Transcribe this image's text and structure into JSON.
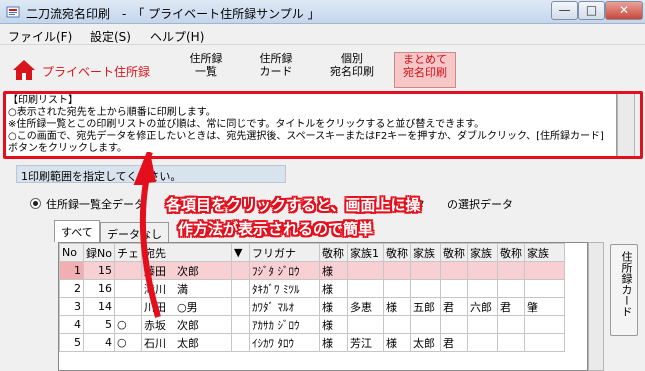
{
  "window": {
    "title": "二刀流宛名印刷　-　「 プライベート住所録サンプル 」",
    "min_label": "—",
    "max_label": "□",
    "close_label": "✕"
  },
  "menu": [
    "ファイル(F)",
    "設定(S)",
    "ヘルプ(H)"
  ],
  "toolbar": {
    "brand_label": "プライベート住所録",
    "buttons": [
      "住所録\n一覧",
      "住所録\nカード",
      "個別\n宛名印刷",
      "まとめて\n宛名印刷"
    ]
  },
  "info": {
    "text": "【印刷リスト】\n○表示された宛先を上から順番に印刷します。\n※住所録一覧とこの印刷リストの並び順は、常に同じです。タイトルをクリックすると並び替えできます。\n○この画面で、宛先データを修正したいときは、宛先選択後、スペースキーまたはF2キーを押すか、ダブルクリック、[住所録カード]ボタンをクリックします。"
  },
  "range": {
    "label": "1印刷範囲を指定してください。",
    "option1": "住所録一覧全データ",
    "option2": "タ　　の選択データ"
  },
  "tabs": [
    "すべて",
    "データなし"
  ],
  "grid": {
    "headers": [
      "No",
      "録No",
      "チェ",
      "宛先",
      "",
      "フリガナ",
      "敬称",
      "家族1",
      "敬称",
      "家族",
      "敬称",
      "家族",
      "敬称",
      "家族"
    ],
    "rows": [
      [
        "1",
        "15",
        "",
        "藤田　次郎",
        "",
        "ﾌｼﾞﾀ ｼﾞﾛｳ",
        "様",
        "",
        "",
        "",
        "",
        "",
        "",
        ""
      ],
      [
        "2",
        "16",
        "",
        "滝川　満",
        "",
        "ﾀｷｶﾞﾜ ﾐﾂﾙ",
        "様",
        "",
        "",
        "",
        "",
        "",
        "",
        ""
      ],
      [
        "3",
        "14",
        "",
        "川田　○男",
        "",
        "ｶﾜﾀﾞ ﾏﾙｵ",
        "様",
        "多恵",
        "様",
        "五郎",
        "君",
        "六郎",
        "君",
        "肇"
      ],
      [
        "4",
        "5",
        "○",
        "赤坂　次郎",
        "",
        "ｱｶｻｶ ｼﾞﾛｳ",
        "様",
        "",
        "",
        "",
        "",
        "",
        "",
        ""
      ],
      [
        "5",
        "4",
        "○",
        "石川　太郎",
        "",
        "ｲｼｶﾜ ﾀﾛｳ",
        "様",
        "芳江",
        "様",
        "太郎",
        "君",
        "",
        "",
        ""
      ]
    ]
  },
  "side_button": "住所録カード",
  "callout": {
    "line1": "各項目をクリックすると、画面上に操",
    "line2": "作方法が表示されるので簡単"
  },
  "colors": {
    "accent_red": "#e30f1c",
    "selected_row": "#f8cfd2",
    "active_tab": "#f7c6c6"
  }
}
